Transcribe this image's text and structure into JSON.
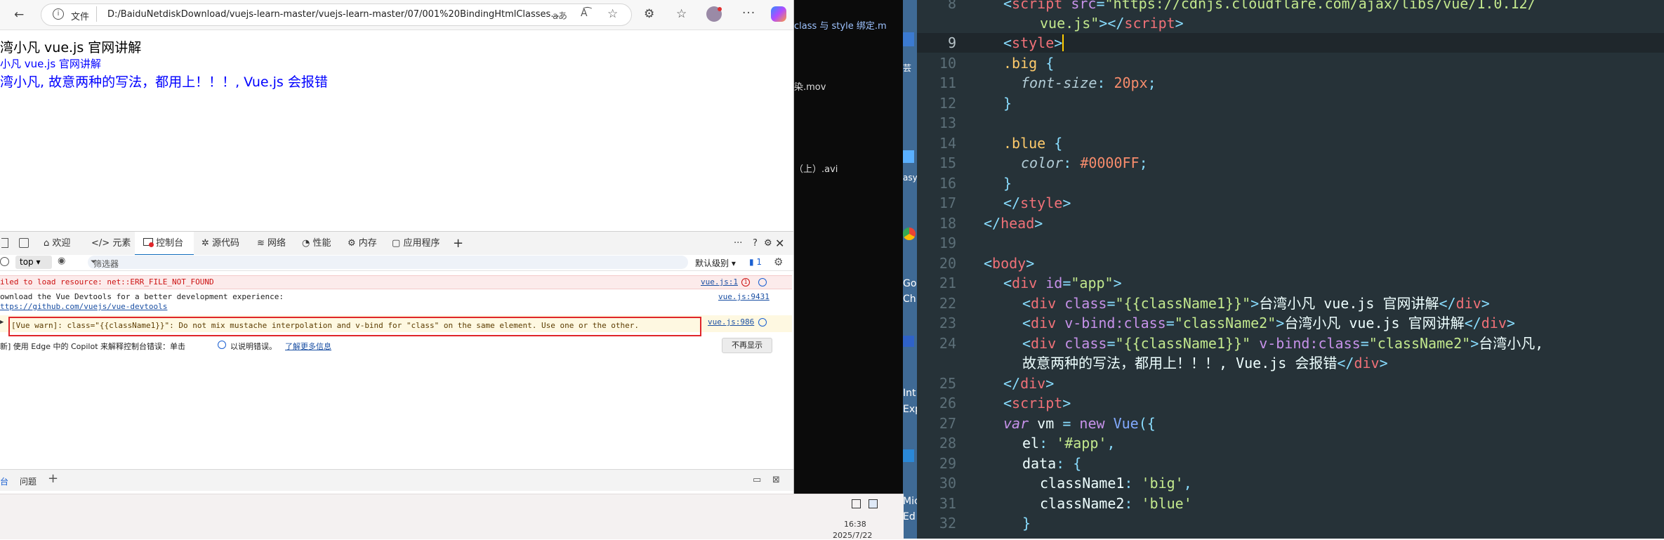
{
  "browser": {
    "file_label": "文件",
    "url": "D:/BaiduNetdiskDownload/vuejs-learn-master/vuejs-learn-master/07/001%20BindingHtmlClasses...",
    "page_lines": [
      "湾小凡 vue.js 官网讲解",
      "小凡 vue.js 官网讲解",
      "湾小凡, 故意两种的写法，都用上！！！, Vue.js 会报错"
    ]
  },
  "devtools": {
    "tabs": [
      "欢迎",
      "元素",
      "控制台",
      "源代码",
      "网络",
      "性能",
      "内存",
      "应用程序"
    ],
    "active_tab": "控制台",
    "context": "top",
    "filter_placeholder": "筛选器",
    "level": "默认级别",
    "issue_count": "1",
    "messages": {
      "error_text": "iled to load resource: net::ERR_FILE_NOT_FOUND",
      "error_src": "vue.js:1",
      "info_text1": "ownload the Vue Devtools for a better development experience:",
      "info_text2": "ttps://github.com/vuejs/vue-devtools",
      "info_src": "vue.js:9431",
      "warn_text": "[Vue warn]: class=\"{{className1}}\": Do not mix mustache interpolation and v-bind for \"class\" on the same element. Use one or the other.",
      "warn_src": "vue.js:986",
      "copilot_text": "新] 使用 Edge 中的 Copilot 来解释控制台错误：单击",
      "copilot_text2": "以说明错误。",
      "copilot_link": "了解更多信息",
      "dismiss": "不再显示"
    },
    "bottom_tabs": [
      "台",
      "问题"
    ]
  },
  "middle": {
    "items": [
      "class 与 style 绑定.m",
      "染.mov",
      "（上）.avi"
    ],
    "side_labels": [
      "芸",
      "asy",
      "Go",
      "Ch",
      "Int",
      "Exp",
      "Mic",
      "Ed"
    ]
  },
  "taskbar": {
    "time": "16:38",
    "date": "2025/7/22"
  },
  "editor": {
    "line_numbers": [
      "8",
      "9",
      "10",
      "11",
      "12",
      "13",
      "14",
      "15",
      "16",
      "17",
      "18",
      "19",
      "20",
      "21",
      "22",
      "23",
      "24",
      "",
      "25",
      "26",
      "27",
      "28",
      "29",
      "30",
      "31",
      "32"
    ]
  },
  "colors": {
    "editor_bg": "#263238",
    "warn_border": "#e0262b",
    "vue_blue": "#0000ff"
  }
}
